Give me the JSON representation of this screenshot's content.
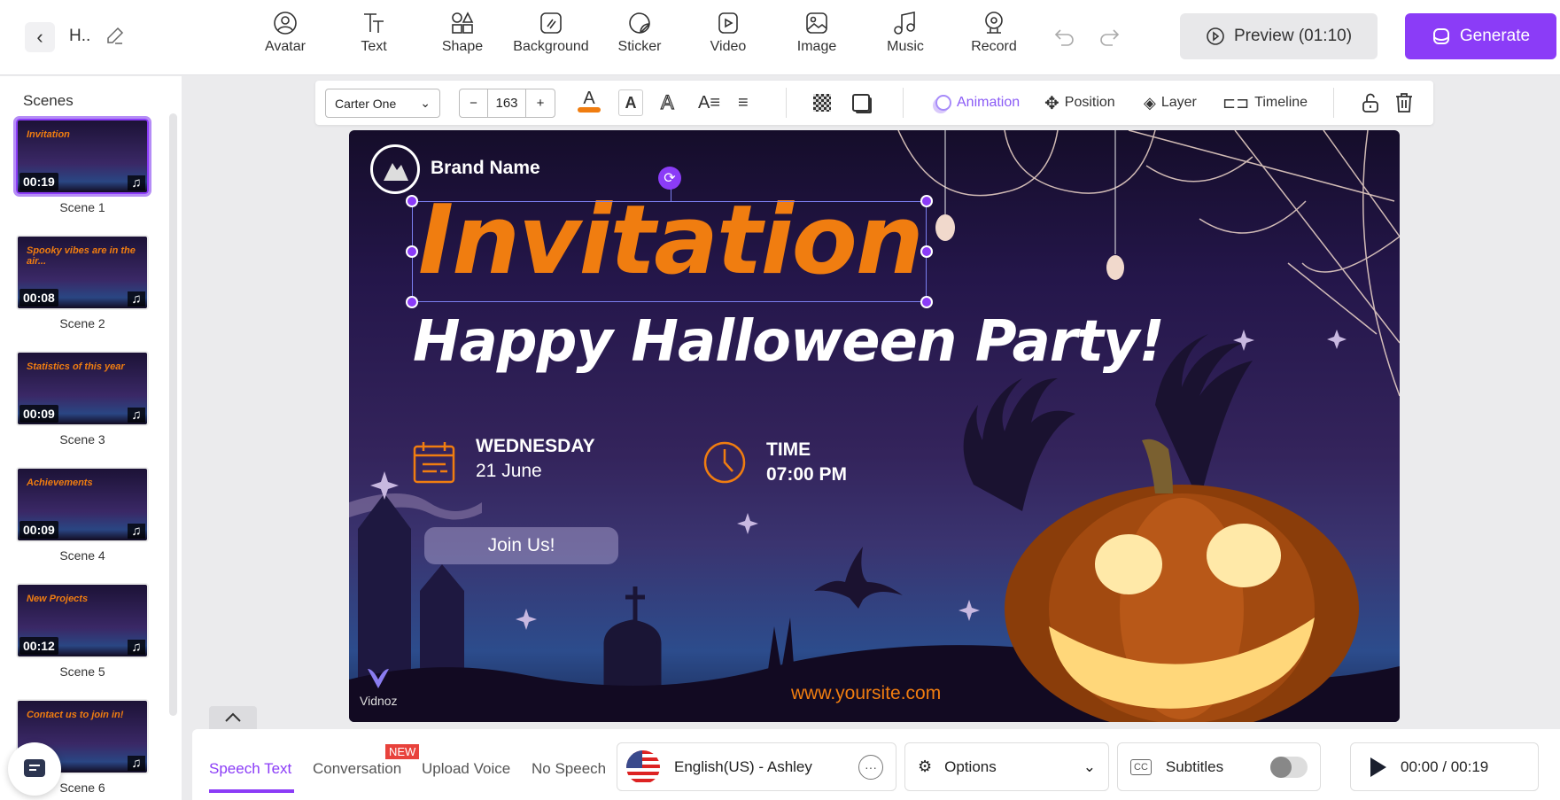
{
  "header": {
    "project_title": "H..",
    "tools": [
      {
        "label": "Avatar",
        "icon": "avatar-icon"
      },
      {
        "label": "Text",
        "icon": "text-icon"
      },
      {
        "label": "Shape",
        "icon": "shape-icon"
      },
      {
        "label": "Background",
        "icon": "background-icon"
      },
      {
        "label": "Sticker",
        "icon": "sticker-icon"
      },
      {
        "label": "Video",
        "icon": "video-icon"
      },
      {
        "label": "Image",
        "icon": "image-icon"
      },
      {
        "label": "Music",
        "icon": "music-icon"
      },
      {
        "label": "Record",
        "icon": "record-icon"
      }
    ],
    "preview_label": "Preview (01:10)",
    "generate_label": "Generate"
  },
  "colors": {
    "accent": "#8b3cf7",
    "orange": "#f07d10"
  },
  "sidebar": {
    "title": "Scenes",
    "scenes": [
      {
        "label": "Scene 1",
        "duration": "00:19",
        "title": "Invitation"
      },
      {
        "label": "Scene 2",
        "duration": "00:08",
        "title": "Spooky vibes are in the air..."
      },
      {
        "label": "Scene 3",
        "duration": "00:09",
        "title": "Statistics of this year"
      },
      {
        "label": "Scene 4",
        "duration": "00:09",
        "title": "Achievements"
      },
      {
        "label": "Scene 5",
        "duration": "00:12",
        "title": "New Projects"
      },
      {
        "label": "Scene 6",
        "duration": "",
        "title": "Contact us to join in!"
      }
    ]
  },
  "format_toolbar": {
    "font": "Carter One",
    "font_size": "163",
    "text_color": "#f07d10",
    "animation": "Animation",
    "position": "Position",
    "layer": "Layer",
    "timeline": "Timeline"
  },
  "canvas": {
    "brand": "Brand Name",
    "title": "Invitation",
    "subtitle": "Happy Halloween Party!",
    "day": "WEDNESDAY",
    "date": "21 June",
    "time_label": "TIME",
    "time": "07:00 PM",
    "button": "Join Us!",
    "website": "www.yoursite.com",
    "watermark": "Vidnoz"
  },
  "bottom": {
    "tabs": [
      "Speech Text",
      "Conversation",
      "Upload Voice",
      "No Speech"
    ],
    "new_badge": "NEW",
    "voice": "English(US) - Ashley",
    "options": "Options",
    "subtitles": "Subtitles",
    "subtitles_on": false,
    "playback": "00:00 / 00:19"
  }
}
